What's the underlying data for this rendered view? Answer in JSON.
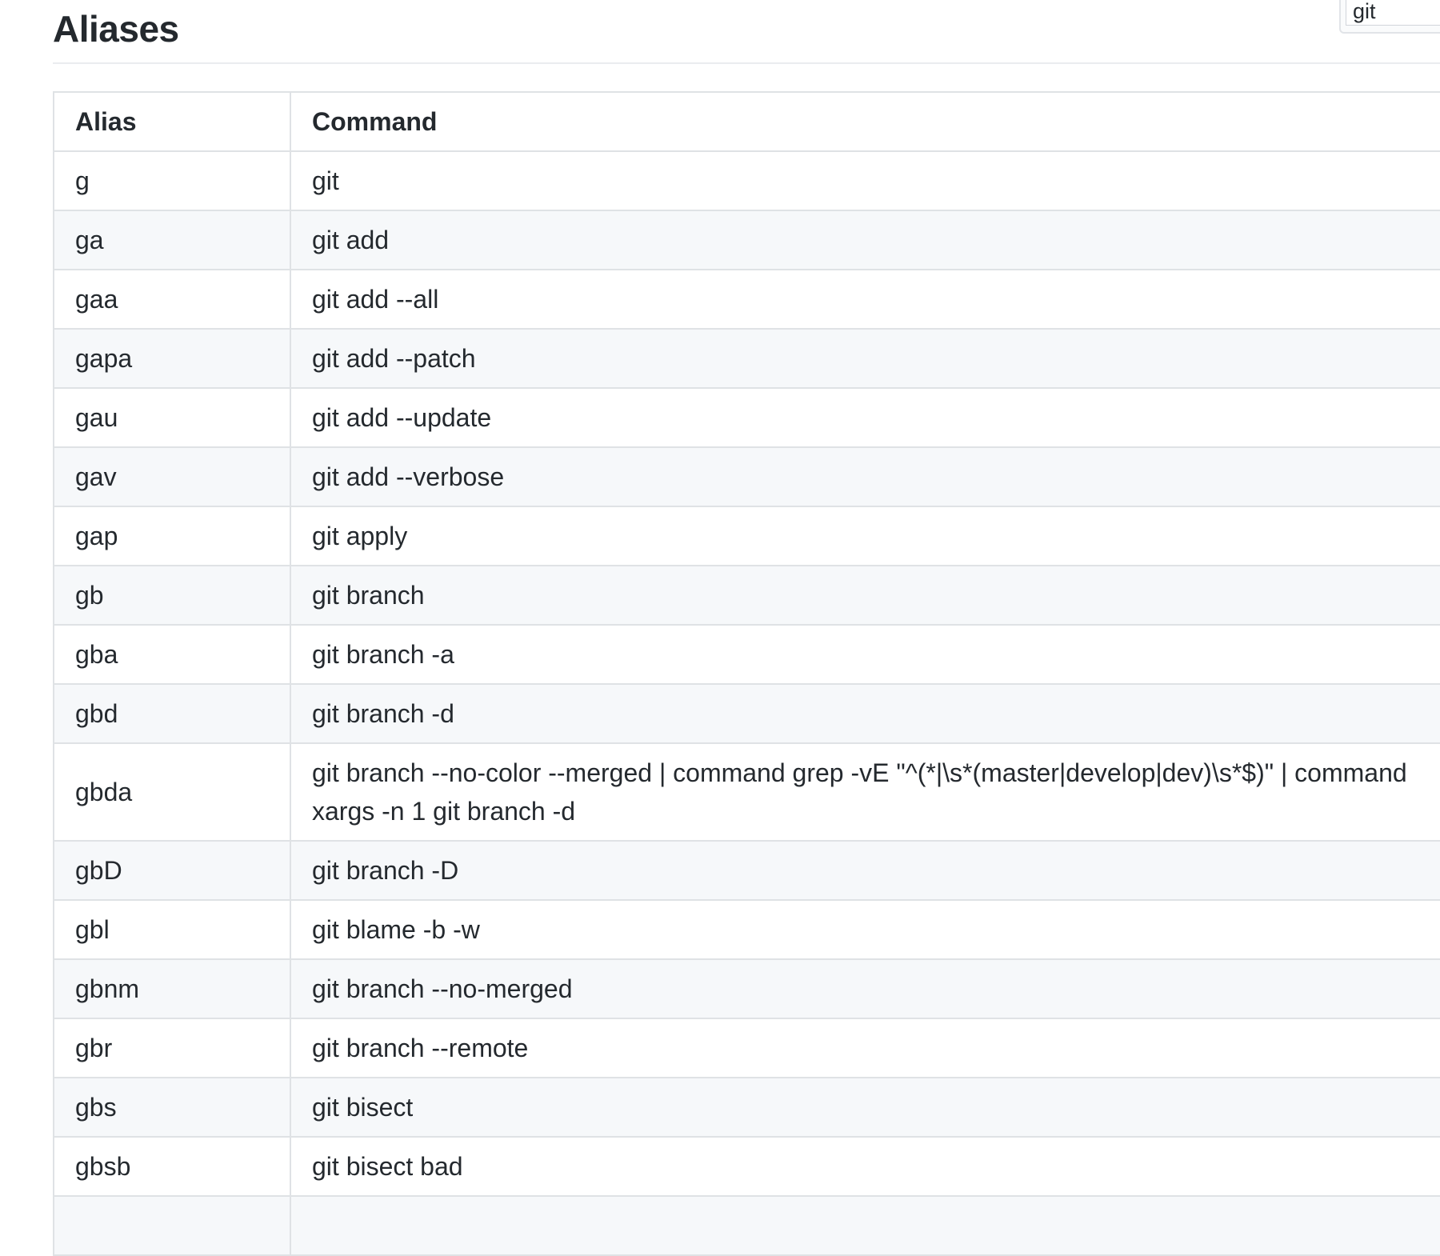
{
  "page": {
    "title": "Aliases"
  },
  "search": {
    "value": "git"
  },
  "table": {
    "headers": {
      "alias": "Alias",
      "command": "Command"
    },
    "rows": [
      {
        "alias": "g",
        "command": "git"
      },
      {
        "alias": "ga",
        "command": "git add"
      },
      {
        "alias": "gaa",
        "command": "git add --all"
      },
      {
        "alias": "gapa",
        "command": "git add --patch"
      },
      {
        "alias": "gau",
        "command": "git add --update"
      },
      {
        "alias": "gav",
        "command": "git add --verbose"
      },
      {
        "alias": "gap",
        "command": "git apply"
      },
      {
        "alias": "gb",
        "command": "git branch"
      },
      {
        "alias": "gba",
        "command": "git branch -a"
      },
      {
        "alias": "gbd",
        "command": "git branch -d"
      },
      {
        "alias": "gbda",
        "command": "git branch --no-color --merged | command grep -vE \"^(*|\\s*(master|develop|dev)\\s*$)\" | command xargs -n 1 git branch -d"
      },
      {
        "alias": "gbD",
        "command": "git branch -D"
      },
      {
        "alias": "gbl",
        "command": "git blame -b -w"
      },
      {
        "alias": "gbnm",
        "command": "git branch --no-merged"
      },
      {
        "alias": "gbr",
        "command": "git branch --remote"
      },
      {
        "alias": "gbs",
        "command": "git bisect"
      },
      {
        "alias": "gbsb",
        "command": "git bisect bad"
      },
      {
        "alias": "",
        "command": ""
      }
    ]
  }
}
